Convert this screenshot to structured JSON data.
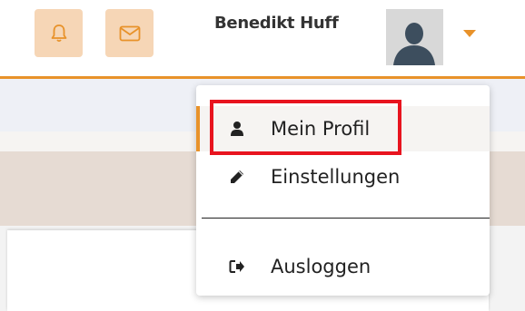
{
  "header": {
    "notifications_icon": "bell-icon",
    "messages_icon": "envelope-icon",
    "user_name": "Benedikt Huff",
    "avatar_icon": "user-silhouette-icon",
    "menu_toggle_icon": "caret-down-icon",
    "accent_color": "#e8922a",
    "button_color": "#f6d6b6"
  },
  "user_menu": {
    "items": [
      {
        "label": "Mein Profil",
        "icon": "user-icon"
      },
      {
        "label": "Einstellungen",
        "icon": "pencil-icon"
      },
      {
        "label": "Ausloggen",
        "icon": "sign-out-icon"
      }
    ],
    "highlight_color": "#e8141f"
  }
}
